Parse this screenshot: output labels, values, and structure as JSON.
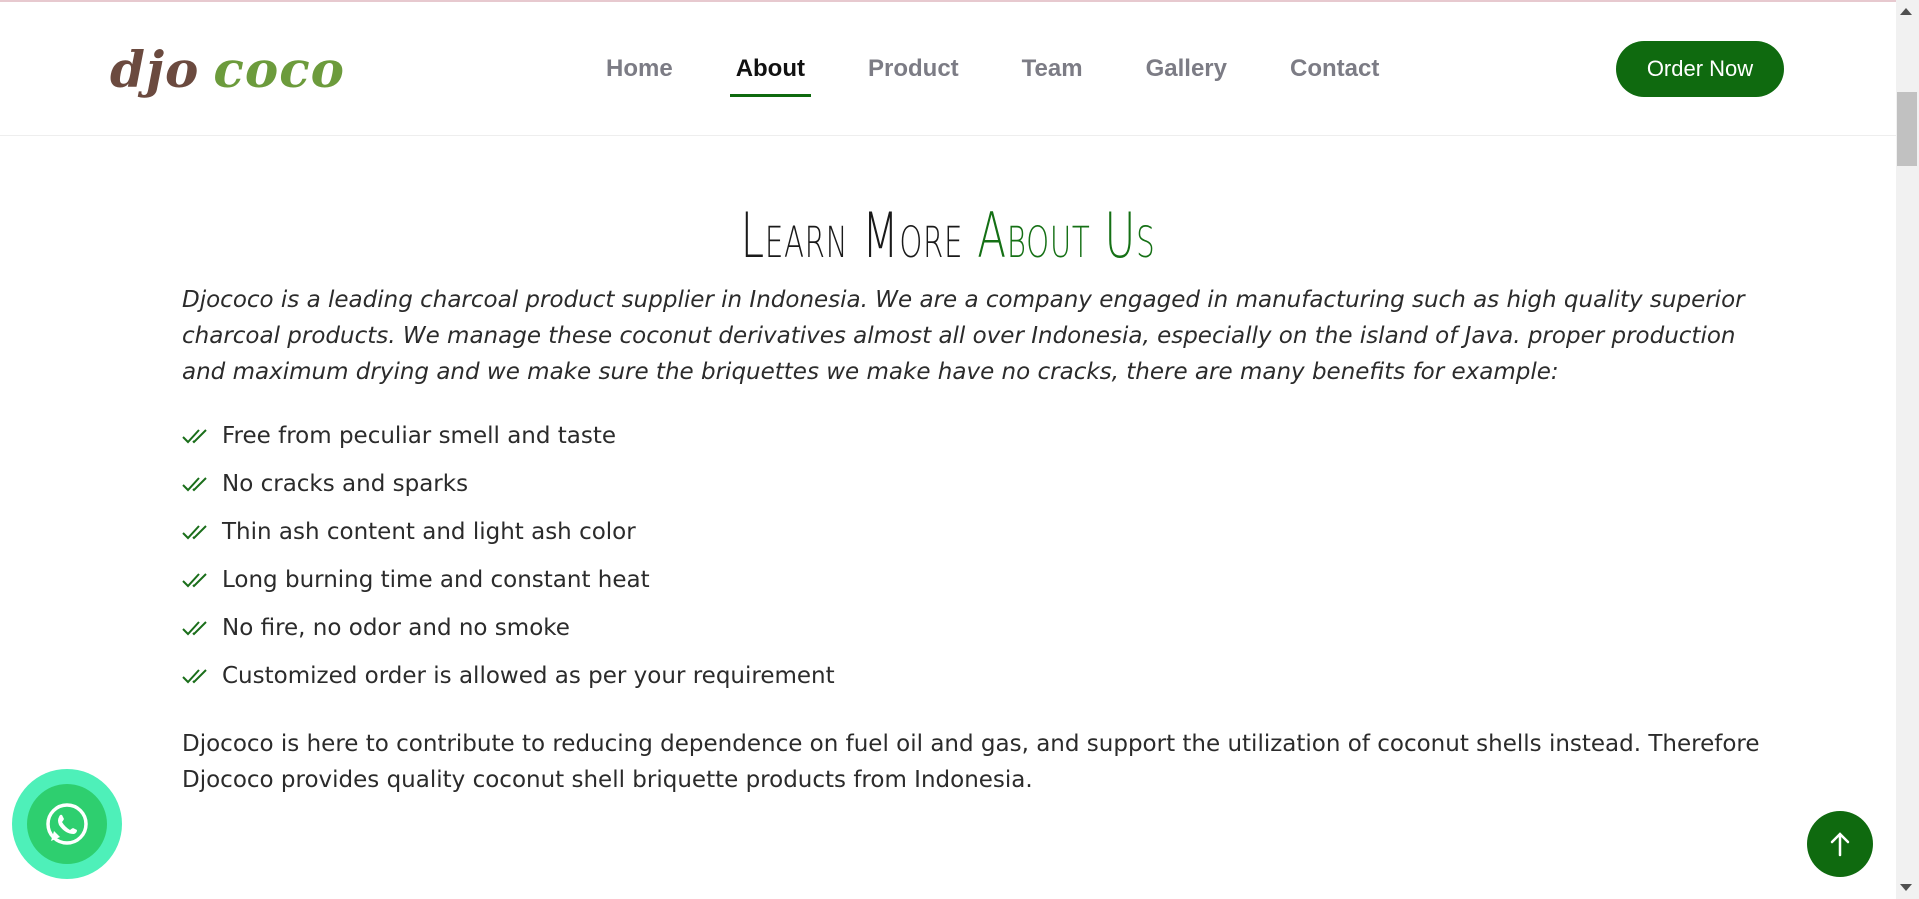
{
  "brand": {
    "part1": "djo",
    "part2": "coco"
  },
  "nav": {
    "items": [
      {
        "label": "Home"
      },
      {
        "label": "About",
        "active": true
      },
      {
        "label": "Product"
      },
      {
        "label": "Team"
      },
      {
        "label": "Gallery"
      },
      {
        "label": "Contact"
      }
    ],
    "cta": "Order Now"
  },
  "about": {
    "title_part1": "Learn More",
    "title_part2": "About Us",
    "intro": "Djococo is a leading charcoal product supplier in Indonesia. We are a company engaged in manufacturing such as high quality superior charcoal products. We manage these coconut derivatives almost all over Indonesia, especially on the island of Java. proper production and maximum drying and we make sure the briquettes we make have no cracks, there are many benefits for example:",
    "benefits": [
      "Free from peculiar smell and taste",
      "No cracks and sparks",
      "Thin ash content and light ash color",
      "Long burning time and constant heat",
      "No fire, no odor and no smoke",
      "Customized order is allowed as per your requirement"
    ],
    "outro": "Djococo is here to contribute to reducing dependence on fuel oil and gas, and support the utilization of coconut shells instead. Therefore Djococo provides quality coconut shell briquette products from Indonesia."
  },
  "icons": {
    "check": "double-check-icon",
    "whatsapp": "whatsapp-icon",
    "back_to_top": "arrow-up-icon"
  },
  "colors": {
    "accent": "#0f6a0f",
    "logo_brown": "#6b4a3f",
    "logo_green": "#6c9b3c",
    "whatsapp": "#2ecf6f"
  }
}
